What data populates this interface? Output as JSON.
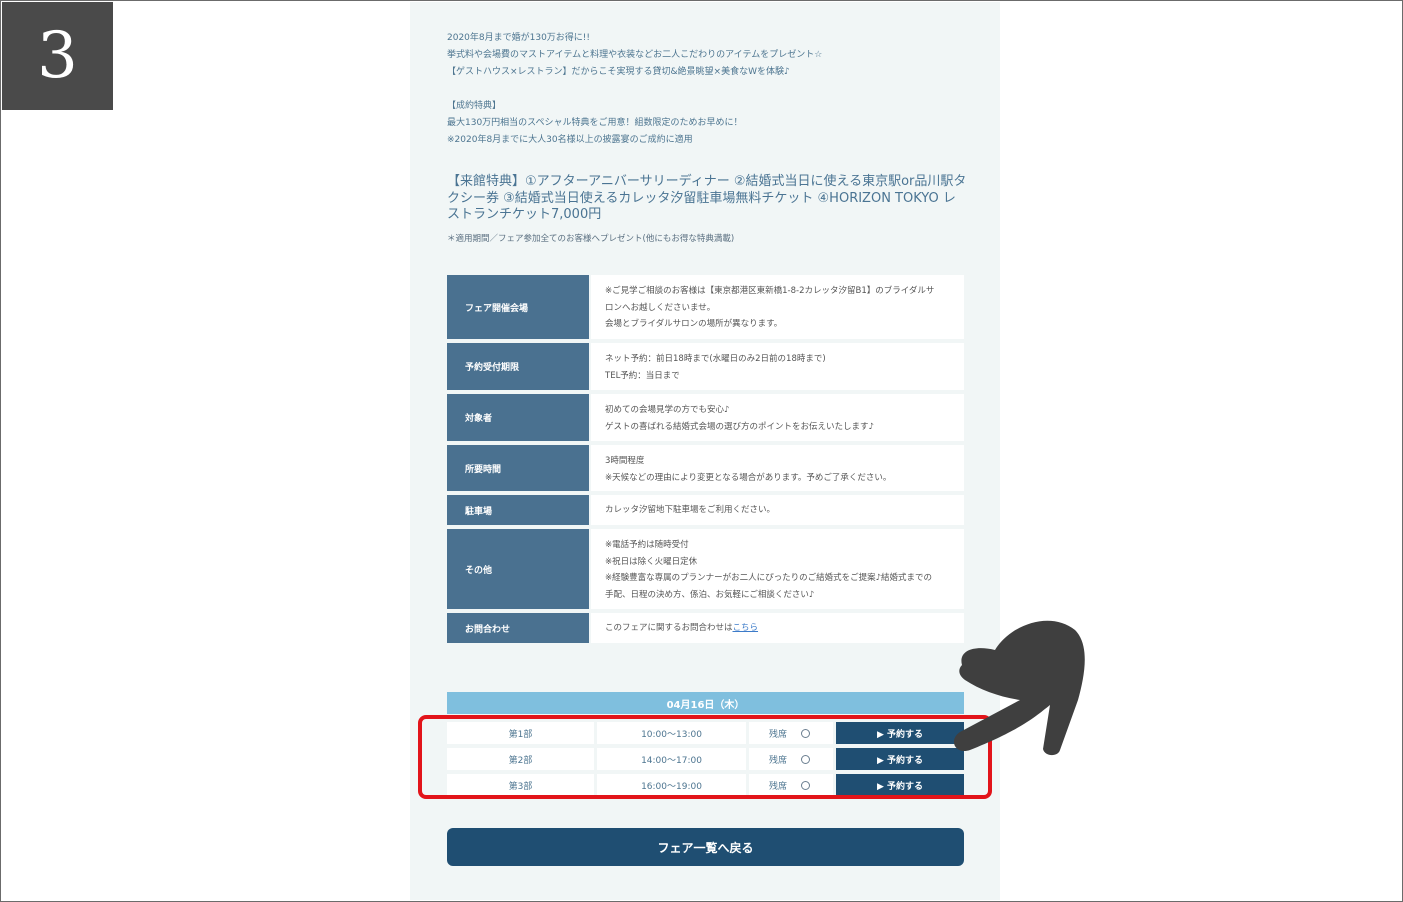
{
  "step_number": "3",
  "intro": {
    "lines": [
      "2020年8月まで婚が130万お得に!!",
      "挙式料や会場費のマストアイテムと料理や衣装などお二人こだわりのアイテムをプレゼント☆",
      "【ゲストハウス×レストラン】だからこそ実現する貸切&絶景眺望×美食なWを体験♪",
      "【成約特典】",
      "最大130万円相当のスペシャル特典をご用意！組数限定のためお早めに！",
      "※2020年8月までに大人30名様以上の披露宴のご成約に適用"
    ]
  },
  "headline": "【来館特典】①アフターアニバーサリーディナー ②結婚式当日に使える東京駅or品川駅タクシー券 ③結婚式当日使えるカレッタ汐留駐車場無料チケット ④HORIZON TOKYO レストランチケット7,000円",
  "note": "＊適用期間／フェア参加全てのお客様へプレゼント(他にもお得な特典満載)",
  "info_rows": [
    {
      "label": "フェア開催会場",
      "lines": [
        "※ご見学ご相談のお客様は【東京都港区東新橋1-8-2カレッタ汐留B1】のブライダルサ",
        "ロンへお越しくださいませ。",
        "会場とブライダルサロンの場所が異なります。"
      ]
    },
    {
      "label": "予約受付期限",
      "lines": [
        "ネット予約：前日18時まで(水曜日のみ2日前の18時まで)",
        "TEL予約：当日まで"
      ]
    },
    {
      "label": "対象者",
      "lines": [
        "初めての会場見学の方でも安心♪",
        "ゲストの喜ばれる結婚式会場の選び方のポイントをお伝えいたします♪"
      ]
    },
    {
      "label": "所要時間",
      "lines": [
        "3時間程度",
        "※天候などの理由により変更となる場合があります。予めご了承ください。"
      ]
    },
    {
      "label": "駐車場",
      "lines": [
        "カレッタ汐留地下駐車場をご利用ください。"
      ]
    },
    {
      "label": "その他",
      "lines": [
        "※電話予約は随時受付",
        "※祝日は除く火曜日定休",
        "※経験豊富な専属のプランナーがお二人にぴったりのご結婚式をご提案♪結婚式までの",
        "手配、日程の決め方、係泊、お気軽にご相談ください♪"
      ]
    },
    {
      "label": "お問合わせ",
      "text": "このフェアに関するお問合わせは",
      "link": "こちら"
    }
  ],
  "date_label": "04月16日（木）",
  "slots": [
    {
      "part": "第1部",
      "time": "10:00～13:00",
      "status": "残席",
      "reserve": "▶ 予約する"
    },
    {
      "part": "第2部",
      "time": "14:00～17:00",
      "status": "残席",
      "reserve": "▶ 予約する"
    },
    {
      "part": "第3部",
      "time": "16:00～19:00",
      "status": "残席",
      "reserve": "▶ 予約する"
    }
  ],
  "back_button": "フェア一覧へ戻る",
  "colors": {
    "highlight": "#e2141a",
    "accent": "#1f4e72",
    "header_cell": "#4a7190",
    "date_bar": "#7fbfde"
  },
  "icons": {
    "pointer": "hand-pointer-icon",
    "availability": "circle-icon"
  }
}
